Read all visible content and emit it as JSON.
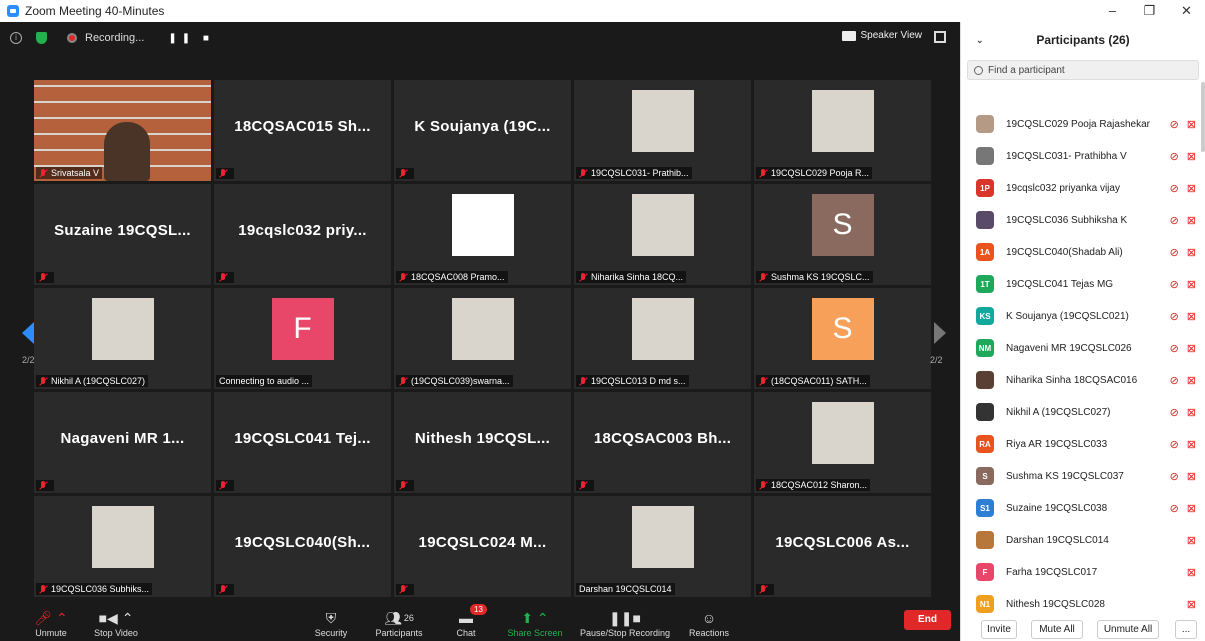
{
  "window": {
    "title": "Zoom Meeting 40-Minutes"
  },
  "topbar": {
    "recording": "Recording...",
    "view": "Speaker View"
  },
  "nav": {
    "page_left": "2/2",
    "page_right": "2/2"
  },
  "tiles": [
    {
      "name": "",
      "label": "Srivatsala V",
      "kind": "video"
    },
    {
      "name": "18CQSAC015 Sh...",
      "label": "",
      "kind": "name"
    },
    {
      "name": "K Soujanya (19C...",
      "label": "",
      "kind": "name"
    },
    {
      "name": "",
      "label": "19CQSLC031- Prathib...",
      "kind": "photo"
    },
    {
      "name": "",
      "label": "19CQSLC029 Pooja R...",
      "kind": "photo"
    },
    {
      "name": "Suzaine 19CQSL...",
      "label": "",
      "kind": "name"
    },
    {
      "name": "19cqslc032 priy...",
      "label": "",
      "kind": "name"
    },
    {
      "name": "",
      "label": "18CQSAC008 Pramo...",
      "kind": "white"
    },
    {
      "name": "",
      "label": "Niharika Sinha 18CQ...",
      "kind": "photo"
    },
    {
      "name": "S",
      "label": "Sushma KS 19CQSLC...",
      "kind": "letter",
      "color": "#8a6a5e"
    },
    {
      "name": "",
      "label": "Nikhil A (19CQSLC027)",
      "kind": "photo"
    },
    {
      "name": "F",
      "label": "Connecting to audio ...",
      "kind": "letter",
      "color": "#e8476a"
    },
    {
      "name": "",
      "label": "(19CQSLC039)swarna...",
      "kind": "photo"
    },
    {
      "name": "",
      "label": "19CQSLC013 D md s...",
      "kind": "photo"
    },
    {
      "name": "S",
      "label": "(18CQSAC011) SATH...",
      "kind": "letter",
      "color": "#f7a05a"
    },
    {
      "name": "Nagaveni MR 1...",
      "label": "",
      "kind": "name"
    },
    {
      "name": "19CQSLC041 Tej...",
      "label": "",
      "kind": "name"
    },
    {
      "name": "Nithesh 19CQSL...",
      "label": "",
      "kind": "name"
    },
    {
      "name": "18CQSAC003 Bh...",
      "label": "",
      "kind": "name"
    },
    {
      "name": "",
      "label": "18CQSAC012 Sharon...",
      "kind": "photo"
    },
    {
      "name": "",
      "label": "19CQSLC036 Subhiks...",
      "kind": "photo"
    },
    {
      "name": "19CQSLC040(Sh...",
      "label": "",
      "kind": "name"
    },
    {
      "name": "19CQSLC024 M...",
      "label": "",
      "kind": "name"
    },
    {
      "name": "",
      "label": "Darshan 19CQSLC014",
      "kind": "photo"
    },
    {
      "name": "19CQSLC006 As...",
      "label": "",
      "kind": "name"
    }
  ],
  "toolbar": {
    "unmute": "Unmute",
    "stop_video": "Stop Video",
    "security": "Security",
    "participants": "Participants",
    "participants_count": "26",
    "chat": "Chat",
    "chat_badge": "13",
    "share": "Share Screen",
    "pause_rec": "Pause/Stop Recording",
    "reactions": "Reactions",
    "end": "End"
  },
  "panel": {
    "title": "Participants (26)",
    "search_placeholder": "Find a participant",
    "participants": [
      {
        "name": "19CQSLC029 Pooja Rajashekar",
        "av": "",
        "color": "#b59a86",
        "mic_off": true
      },
      {
        "name": "19CQSLC031- Prathibha V",
        "av": "",
        "color": "#777",
        "mic_off": true
      },
      {
        "name": "19cqslc032 priyanka vijay",
        "av": "1P",
        "color": "#d9352b",
        "mic_off": true
      },
      {
        "name": "19CQSLC036 Subhiksha K",
        "av": "",
        "color": "#5a4a6a",
        "mic_off": true
      },
      {
        "name": "19CQSLC040(Shadab Ali)",
        "av": "1A",
        "color": "#e8531e",
        "mic_off": true
      },
      {
        "name": "19CQSLC041 Tejas MG",
        "av": "1T",
        "color": "#1fa85a",
        "mic_off": true
      },
      {
        "name": "K Soujanya (19CQSLC021)",
        "av": "KS",
        "color": "#13a89e",
        "mic_off": true
      },
      {
        "name": "Nagaveni MR 19CQSLC026",
        "av": "NM",
        "color": "#1fa85a",
        "mic_off": true
      },
      {
        "name": "Niharika Sinha 18CQSAC016",
        "av": "",
        "color": "#5a4034",
        "mic_off": true
      },
      {
        "name": "Nikhil A (19CQSLC027)",
        "av": "",
        "color": "#333",
        "mic_off": true
      },
      {
        "name": "Riya AR 19CQSLC033",
        "av": "RA",
        "color": "#e8531e",
        "mic_off": true
      },
      {
        "name": "Sushma KS 19CQSLC037",
        "av": "S",
        "color": "#8a6a5e",
        "mic_off": true
      },
      {
        "name": "Suzaine 19CQSLC038",
        "av": "S1",
        "color": "#2d7fd6",
        "mic_off": true
      },
      {
        "name": "Darshan 19CQSLC014",
        "av": "",
        "color": "#b8773a",
        "mic_off": false
      },
      {
        "name": "Farha 19CQSLC017",
        "av": "F",
        "color": "#e8476a",
        "mic_off": false
      },
      {
        "name": "Nithesh 19CQSLC028",
        "av": "N1",
        "color": "#f0a020",
        "mic_off": false
      }
    ],
    "invite": "Invite",
    "mute_all": "Mute All",
    "unmute_all": "Unmute All",
    "more": "..."
  }
}
